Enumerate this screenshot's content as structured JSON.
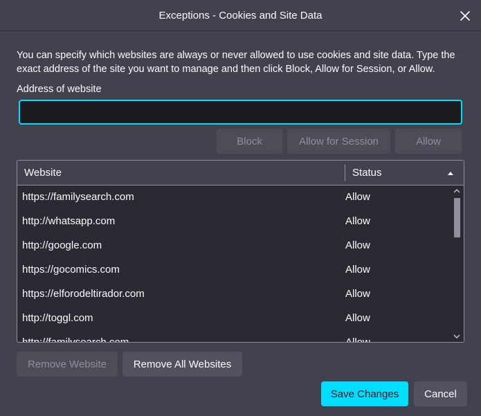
{
  "dialog": {
    "title": "Exceptions - Cookies and Site Data",
    "description": "You can specify which websites are always or never allowed to use cookies and site data. Type the exact address of the site you want to manage and then click Block, Allow for Session, or Allow.",
    "address_label": "Address of website",
    "address_value": "",
    "address_placeholder": ""
  },
  "actions": {
    "block_label": "Block",
    "allow_session_label": "Allow for Session",
    "allow_label": "Allow"
  },
  "table": {
    "columns": [
      "Website",
      "Status"
    ],
    "sort_column": "Status",
    "rows": [
      {
        "site": "https://familysearch.com",
        "status": "Allow"
      },
      {
        "site": "http://whatsapp.com",
        "status": "Allow"
      },
      {
        "site": "http://google.com",
        "status": "Allow"
      },
      {
        "site": "https://gocomics.com",
        "status": "Allow"
      },
      {
        "site": "https://elforodeltirador.com",
        "status": "Allow"
      },
      {
        "site": "http://toggl.com",
        "status": "Allow"
      },
      {
        "site": "http://familysearch.com",
        "status": "Allow"
      }
    ]
  },
  "footer": {
    "remove_website_label": "Remove Website",
    "remove_all_label": "Remove All Websites",
    "save_label": "Save Changes",
    "cancel_label": "Cancel"
  },
  "colors": {
    "background": "#42414d",
    "field": "#1c1b22",
    "list": "#2b2a33",
    "accent": "#00ddff"
  },
  "icons": [
    "close-icon",
    "sort-ascending-icon",
    "scroll-up-icon",
    "scroll-down-icon"
  ]
}
